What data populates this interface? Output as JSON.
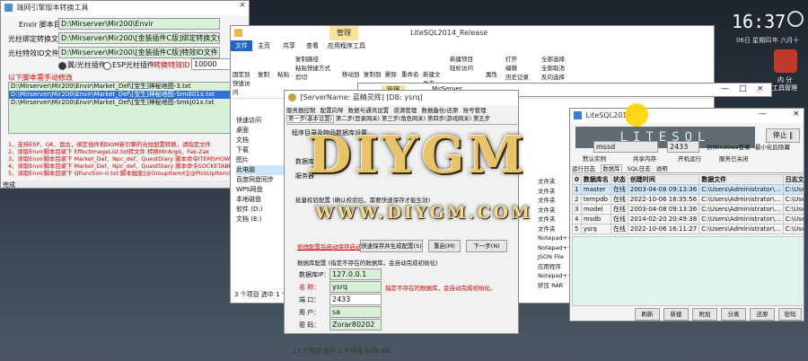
{
  "desktop": {
    "clock": "16:37",
    "date_line": "06日 星期四",
    "lunar_line": "年 六月十",
    "icons": [
      "内 分",
      "工具管理"
    ],
    "watermark": "DIYGM",
    "watermark_url": "WWW.DIYGM.COM"
  },
  "tool_window": {
    "title": "端网引擎版本转换工具",
    "close": "×",
    "label_envir": "Envir 脚本目录：",
    "value_envir": "D:\\Mirserver\\Mir200\\Envir",
    "label_bind": "光柱绑定转换文件：",
    "value_bind": "D:\\Mirserver\\Mir200\\[金装插件C版]绑定转换文件.txt",
    "label_special": "光柱特效ID文件：",
    "value_special": "D:\\Mirserver\\Mir200\\[金装插件C版]特效ID文件.txt",
    "option_a": "翼/光柱插件",
    "option_b": "ESP光柱插件",
    "convert_label": "转换特效ID：X =",
    "convert_value": "10000",
    "section_label": "以下脚本需手动修改",
    "files": [
      "D:\\Mirserver\\Mir200\\Envir\\Market_Def\\[宝生]神秘地图-3.txt",
      "D:\\Mirserver\\Mir200\\Envir\\Market_Def\\[宝生]神秘地图-Smdl01x.txt",
      "D:\\Mirserver\\Mir200\\Envir\\Market_Def\\[宝生]神秘地图-Smkj01x.txt"
    ],
    "notes": [
      "1、支持ESP、GK、盘古，绑定插件和DOM新引擎的光柱配置转换，请指定文件",
      "2、读取Envir脚本目录下 EffectImageList.txt转文件 转换MirArgd、Fak-Zak",
      "3、读取Envir脚本目录下 Market_Def、Npc_def、QuestDiary 脚本命令ITEMSHOW，转换ID=X",
      "4、读取Envir脚本目录下 Market_Def、Npc_def、QuestDiary 脚本命令SOCKETABLEITEM，转换ID",
      "5、读取Envir脚本目录下 QFunction-0.txt 脚本触发[@GroupItemX][@PickUpItemX]，转换ID=X"
    ],
    "status": "完成"
  },
  "explorer_window": {
    "title_tab": "管理",
    "title": "LiteSQL2014_Release",
    "tabs": [
      "文件",
      "主页",
      "共享",
      "查看",
      "应用程序工具"
    ],
    "ribbon": {
      "pin": "固定到快速访问",
      "copy": "复制",
      "paste": "粘贴",
      "copy_path": "复制路径",
      "paste_shortcut": "粘贴快捷方式",
      "cut": "剪切",
      "move_to": "移动到",
      "copy_to": "复制到",
      "delete": "删除",
      "rename": "重命名",
      "new_folder": "新建文件夹",
      "new_item": "新建项目",
      "easy_access": "轻松访问",
      "properties": "属性",
      "open": "打开",
      "edit": "编辑",
      "history": "历史记录",
      "select_all": "全部选择",
      "select_none": "全部取消",
      "invert": "反向选择"
    },
    "nav": [
      "快速访问",
      "桌面",
      "文档",
      "下载",
      "图片",
      "此电脑",
      "百度网盘同步",
      "WPS网盘",
      "本地磁盘",
      "软件 (D:)",
      "文档 (E:)"
    ],
    "types": [
      "文件夹",
      "文件夹",
      "文件夹",
      "文件夹",
      "文件夹",
      "文件夹",
      "Notepad++",
      "Notepad++",
      "JSON File",
      "应用程序",
      "Notepad++",
      "好压 RAR"
    ],
    "status": "3 个项目   选中 1 个项目"
  },
  "explorer2_window": {
    "title_tab": "管理",
    "title": "MirServer",
    "status": "15 个项目   选中 1 个项目 6.08 MB"
  },
  "server_window": {
    "title": "[ServerName: 蓝精灵辉] [DB: ysrq]",
    "menu": [
      "服务器控制",
      "配置向导",
      "数据与通讯设置",
      "资源管理",
      "数据备份/还原",
      "账号管理",
      "服务器"
    ],
    "steps": [
      "第一步(基本设置)",
      "第二步(登录网关)",
      "第三步(角色网关)",
      "第四步(游戏网关)",
      "第五步"
    ],
    "group_title": "程序目录及物品数据库设置",
    "rows": [
      "数据库",
      "服务器"
    ],
    "batch_title": "批量校验配置 (确认校验后，需要快速保存才能生效)",
    "link": "修改配置后启动保存启动",
    "btn_save": "快速保存并生成配置(S)",
    "btn_restore": "重启(M)",
    "btn_next": "下一步(N)",
    "db_group": "数据库配置 (指定不存在的数据库，会自动完成初始化)",
    "ip_label": "数据库IP：",
    "ip_value": "127.0.0.1",
    "name_label": "名   称：",
    "name_value": "ysrq",
    "name_hint": "指定不存在的数据库，会自动完成初始化。",
    "port_label": "端   口：",
    "port_value": "2433",
    "user_label": "用   户：",
    "user_value": "sa",
    "pwd_label": "密   码：",
    "pwd_value": "Zorar80202"
  },
  "litesql_window": {
    "title": "LiteSQL2014",
    "logo": "LITESQL",
    "btn_stop": "停止 ‖",
    "field_mssql": "mssd",
    "field_port": "2433",
    "chk_windows": "仿Windows登录",
    "chk_hide": "最小化后隐藏",
    "chk_default": "默认实例",
    "chk_shared": "共享内存",
    "chk_start": "开机运行",
    "chk_service": "服务已关闭",
    "tabs": [
      "运行日志",
      "数据库",
      "SQL日志",
      "说明"
    ],
    "columns": [
      "0",
      "数据库名",
      "状态",
      "创建时间",
      "数据文件",
      "日志文件"
    ],
    "rows": [
      {
        "n": "1",
        "name": "master",
        "status": "在线",
        "time": "2003-04-08 09:13:36",
        "data": "C:\\Users\\Administrator\\...",
        "log": "C:\\Users\\Administrat..."
      },
      {
        "n": "2",
        "name": "tempdb",
        "status": "在线",
        "time": "2022-10-06 16:35:56",
        "data": "C:\\Users\\Administrator\\...",
        "log": "C:\\Users\\Administrat..."
      },
      {
        "n": "3",
        "name": "model",
        "status": "在线",
        "time": "2003-04-08 09:13:36",
        "data": "C:\\Users\\Administrator\\...",
        "log": "C:\\Users\\Administrat..."
      },
      {
        "n": "4",
        "name": "msdb",
        "status": "在线",
        "time": "2014-02-20 20:49:38",
        "data": "C:\\Users\\Administrator\\...",
        "log": "C:\\Users\\Administrat..."
      },
      {
        "n": "5",
        "name": "ysrq",
        "status": "在线",
        "time": "2022-10-06 16:11:27",
        "data": "C:\\Users\\Administrator\\...",
        "log": "C:\\Users\\Administrat..."
      }
    ],
    "buttons": [
      "刷新",
      "新建",
      "附加",
      "分离",
      "还原",
      "密码"
    ]
  }
}
